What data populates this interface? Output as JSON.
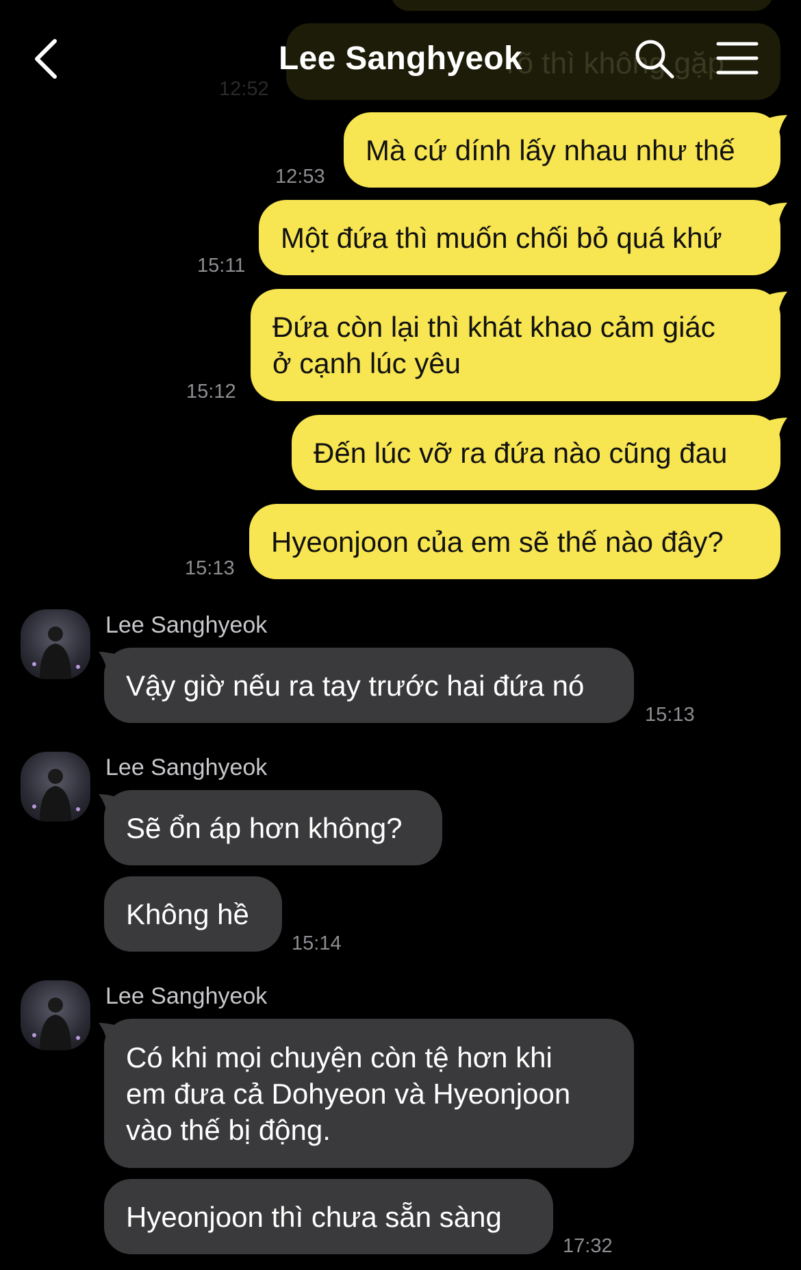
{
  "header": {
    "title": "Lee Sanghyeok",
    "peek_text": "rõ thì không gặp",
    "peek_time": "12:52"
  },
  "outgoing": [
    {
      "text": "Mà cứ dính lấy nhau như thế",
      "time": "12:53"
    },
    {
      "text": "Một đứa thì muốn chối bỏ quá khứ",
      "time": "15:11"
    },
    {
      "text": "Đứa còn lại thì khát khao cảm giác",
      "text2": "ở cạnh lúc yêu",
      "time": "15:12"
    },
    {
      "text": "Đến lúc vỡ ra đứa nào cũng đau",
      "time": ""
    },
    {
      "text": "Hyeonjoon của em sẽ thế nào đây?",
      "time": "15:13"
    }
  ],
  "incoming": [
    {
      "sender": "Lee Sanghyeok",
      "messages": [
        {
          "text": "Vậy giờ nếu ra tay trước hai đứa nó",
          "time": "15:13"
        }
      ]
    },
    {
      "sender": "Lee Sanghyeok",
      "messages": [
        {
          "text": "Sẽ ổn áp hơn không?",
          "time": ""
        },
        {
          "text": "Không hề",
          "time": "15:14"
        }
      ]
    },
    {
      "sender": "Lee Sanghyeok",
      "messages": [
        {
          "line1": "Có khi mọi chuyện còn tệ hơn khi",
          "line2": "em đưa cả Dohyeon và Hyeonjoon",
          "line3": "vào thế bị động.",
          "time": ""
        },
        {
          "text": "Hyeonjoon thì chưa sẵn sàng",
          "time": "17:32"
        }
      ]
    }
  ],
  "colors": {
    "outgoing_bubble": "#f7e551",
    "incoming_bubble": "#3a3a3c",
    "background": "#000000",
    "timestamp": "#8e8e93"
  },
  "icons": {
    "back": "chevron-left-icon",
    "search": "search-icon",
    "menu": "hamburger-menu-icon"
  }
}
